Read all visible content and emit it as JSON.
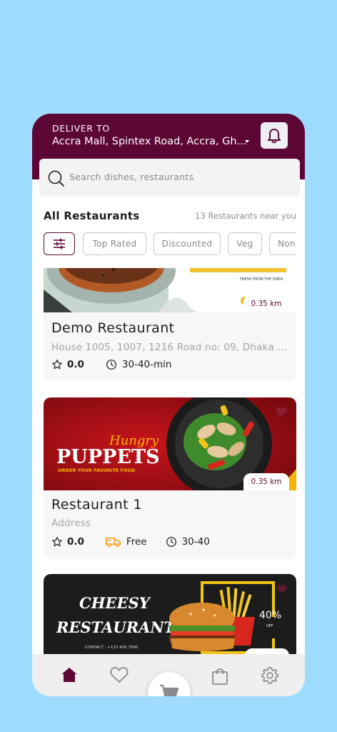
{
  "header": {
    "deliver_label": "DELIVER TO",
    "address": "Accra Mall, Spintex Road, Accra, Gh...",
    "bell_icon": "bell-icon"
  },
  "search": {
    "placeholder": "Search dishes, restaurants",
    "icon": "search-icon"
  },
  "section": {
    "title": "All Restaurants",
    "count_text": "13 Restaurants near you"
  },
  "filters": {
    "icon": "sliders-icon",
    "chips": [
      "Top Rated",
      "Discounted",
      "Veg",
      "Non"
    ]
  },
  "restaurants": [
    {
      "name": "Demo Restaurant",
      "address": "House 1005, 1007, 1216 Road no: 09, Dhaka ...",
      "distance": "0.35 km",
      "rating": "0.0",
      "time": "30-40-min",
      "banner_text": {
        "tag": "FRESH FROM THE OVEN"
      }
    },
    {
      "name": "Restaurant 1",
      "address": "Address",
      "distance": "0.35 km",
      "rating": "0.0",
      "delivery": "Free",
      "time": "30-40",
      "banner_text": {
        "script": "Hungry",
        "title": "PUPPETS",
        "tag": "ORDER YOUR FAVORITE FOOD"
      }
    },
    {
      "name": "Cheesy Restaurant",
      "banner_text": {
        "line1": "CHEESY",
        "line2": "RESTAURANT",
        "contact": "CONTACT : +123 456 7890",
        "discount": "40%",
        "off": "OFF"
      }
    }
  ],
  "bottom_nav": {
    "items": [
      "home-icon",
      "heart-icon",
      "cart-icon",
      "bag-icon",
      "settings-icon"
    ]
  },
  "colors": {
    "brand": "#5c0636",
    "background": "#9edcff",
    "accent_orange": "#f29d1d"
  }
}
